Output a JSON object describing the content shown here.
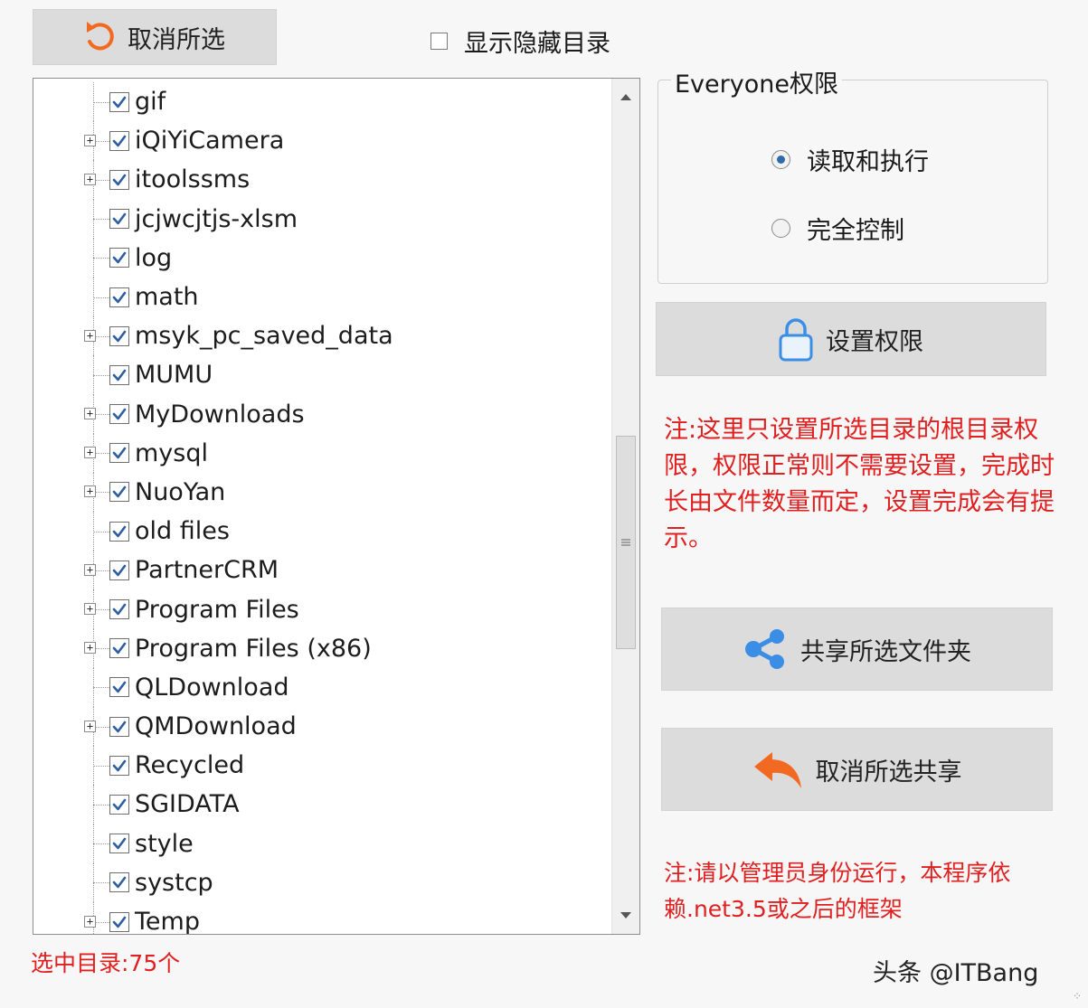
{
  "toolbar": {
    "cancel_select_label": "取消所选",
    "show_hidden_label": "显示隐藏目录",
    "show_hidden_checked": false
  },
  "tree": {
    "items": [
      {
        "label": "gif",
        "expandable": false,
        "checked": true
      },
      {
        "label": "iQiYiCamera",
        "expandable": true,
        "checked": true
      },
      {
        "label": "itoolssms",
        "expandable": true,
        "checked": true
      },
      {
        "label": "jcjwcjtjs-xlsm",
        "expandable": false,
        "checked": true
      },
      {
        "label": "log",
        "expandable": false,
        "checked": true
      },
      {
        "label": "math",
        "expandable": false,
        "checked": true
      },
      {
        "label": "msyk_pc_saved_data",
        "expandable": true,
        "checked": true
      },
      {
        "label": "MUMU",
        "expandable": false,
        "checked": true
      },
      {
        "label": "MyDownloads",
        "expandable": true,
        "checked": true
      },
      {
        "label": "mysql",
        "expandable": true,
        "checked": true
      },
      {
        "label": "NuoYan",
        "expandable": true,
        "checked": true
      },
      {
        "label": "old files",
        "expandable": false,
        "checked": true
      },
      {
        "label": "PartnerCRM",
        "expandable": true,
        "checked": true
      },
      {
        "label": "Program Files",
        "expandable": true,
        "checked": true
      },
      {
        "label": "Program Files (x86)",
        "expandable": true,
        "checked": true
      },
      {
        "label": "QLDownload",
        "expandable": false,
        "checked": true
      },
      {
        "label": "QMDownload",
        "expandable": true,
        "checked": true
      },
      {
        "label": "Recycled",
        "expandable": false,
        "checked": true
      },
      {
        "label": "SGIDATA",
        "expandable": false,
        "checked": true
      },
      {
        "label": "style",
        "expandable": false,
        "checked": true
      },
      {
        "label": "systcp",
        "expandable": false,
        "checked": true
      },
      {
        "label": "Temp",
        "expandable": true,
        "checked": true
      }
    ]
  },
  "status": {
    "selected_count": "选中目录:75个"
  },
  "permissions": {
    "group_title": "Everyone权限",
    "option_read_exec": "读取和执行",
    "option_full_control": "完全控制",
    "selected": "read_exec",
    "set_button": "设置权限",
    "note": "注:这里只设置所选目录的根目录权限，权限正常则不需要设置，完成时长由文件数量而定，设置完成会有提示。"
  },
  "share": {
    "share_button": "共享所选文件夹",
    "cancel_share_button": "取消所选共享",
    "note": "注:请以管理员身份运行，本程序依赖.net3.5或之后的框架"
  },
  "watermark": "头条 @ITBang",
  "colors": {
    "note_red": "#e02020",
    "accent_orange": "#f26a21",
    "accent_blue": "#3a8ee6",
    "button_bg": "#dcdcdc"
  },
  "icons": {
    "cancel_select": "undo-arrow-icon",
    "set_perm": "lock-icon",
    "share": "share-icon",
    "cancel_share": "reply-arrow-icon"
  }
}
